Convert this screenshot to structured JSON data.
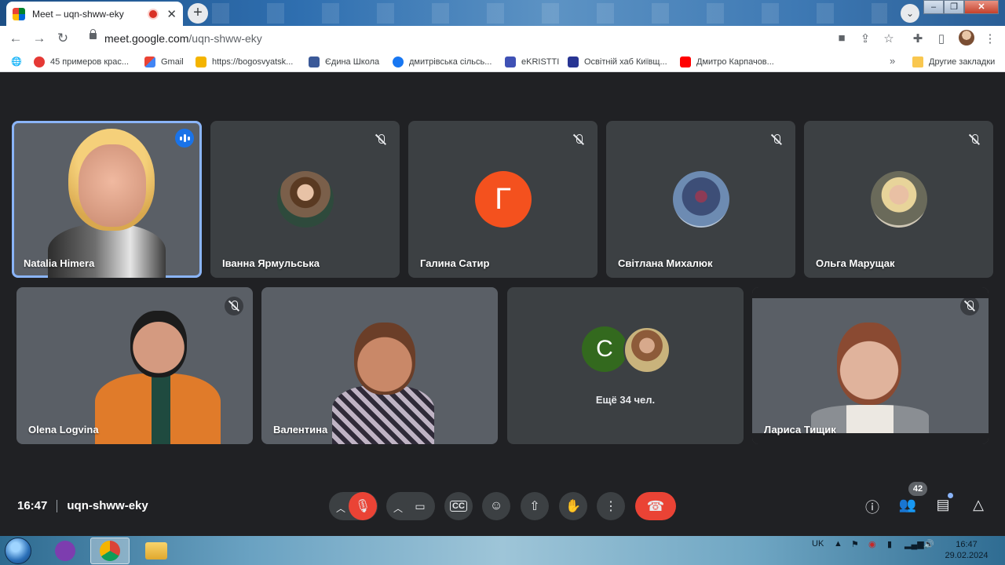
{
  "browser": {
    "tab_title": "Meet – uqn-shww-eky",
    "url_host": "meet.google.com",
    "url_path": "/uqn-shww-eky",
    "bookmarks": [
      {
        "label": "45 примеров крас...",
        "icon": "red-circle-icon",
        "color": "#e53935"
      },
      {
        "label": "Gmail",
        "icon": "gmail-icon",
        "color": "#ea4335"
      },
      {
        "label": "https://bogosvyatsk...",
        "icon": "trident-icon",
        "color": "#f4b400"
      },
      {
        "label": "Єдина Школа",
        "icon": "school-icon",
        "color": "#3b5998"
      },
      {
        "label": "дмитрівська сільсь...",
        "icon": "facebook-icon",
        "color": "#1877f2"
      },
      {
        "label": "eKRISTTI",
        "icon": "ekristti-icon",
        "color": "#3f51b5"
      },
      {
        "label": "Освітній хаб Київщ...",
        "icon": "hub-icon",
        "color": "#283593"
      },
      {
        "label": "Дмитро Карпачов...",
        "icon": "youtube-icon",
        "color": "#ff0000"
      }
    ],
    "other_bookmarks": "Другие закладки"
  },
  "tiles_top": [
    {
      "name": "Natalia Himera",
      "type": "video",
      "speaking": true
    },
    {
      "name": "Іванна Ярмульська",
      "type": "photo",
      "muted": true
    },
    {
      "name": "Галина Сатир",
      "type": "letter",
      "letter": "Г",
      "muted": true
    },
    {
      "name": "Світлана Михалюк",
      "type": "photo",
      "muted": true
    },
    {
      "name": "Ольга Марущак",
      "type": "photo",
      "muted": true
    }
  ],
  "tiles_bottom": [
    {
      "name": "Olena Logvina",
      "type": "video",
      "muted": true
    },
    {
      "name": "Валентина",
      "type": "video",
      "muted": false
    },
    {
      "name": "",
      "type": "more",
      "letter": "C",
      "label": "Ещё 34 чел."
    },
    {
      "name": "Лариса Тищик",
      "type": "video",
      "muted": true
    }
  ],
  "controls": {
    "time": "16:47",
    "meeting_code": "uqn-shww-eky",
    "participants_count": "42"
  },
  "taskbar": {
    "lang": "UK",
    "clock_time": "16:47",
    "clock_date": "29.02.2024"
  },
  "colors": {
    "meet_bg": "#202124",
    "tile_bg": "#3c4043",
    "hangup_red": "#ea4335",
    "active_outline": "#8ab4f8",
    "letter_avatar": "#f4511e",
    "more_avatar": "#33691e"
  }
}
